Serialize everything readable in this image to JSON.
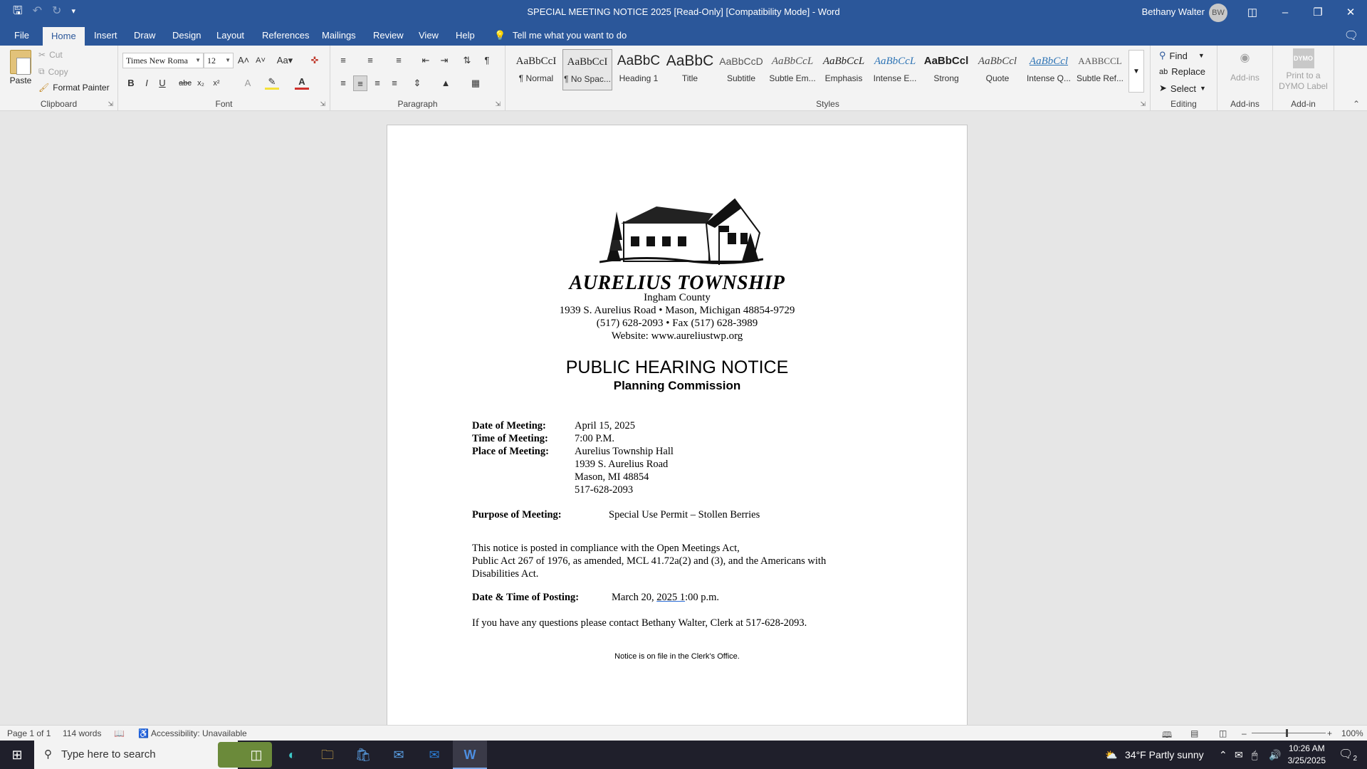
{
  "window": {
    "title": "SPECIAL MEETING NOTICE 2025 [Read-Only] [Compatibility Mode]  -  Word",
    "user_name": "Bethany Walter",
    "user_initials": "BW"
  },
  "tabs": [
    "File",
    "Home",
    "Insert",
    "Draw",
    "Design",
    "Layout",
    "References",
    "Mailings",
    "Review",
    "View",
    "Help"
  ],
  "tell_me": "Tell me what you want to do",
  "ribbon": {
    "clipboard": {
      "paste": "Paste",
      "cut": "Cut",
      "copy": "Copy",
      "format_painter": "Format Painter",
      "label": "Clipboard"
    },
    "font": {
      "name": "Times New Roma",
      "size": "12",
      "label": "Font"
    },
    "paragraph": {
      "label": "Paragraph"
    },
    "styles": {
      "label": "Styles",
      "items": [
        {
          "preview": "AaBbCcI",
          "name": "¶ Normal"
        },
        {
          "preview": "AaBbCcI",
          "name": "¶ No Spac..."
        },
        {
          "preview": "AaBbC",
          "name": "Heading 1"
        },
        {
          "preview": "AaBbC",
          "name": "Title"
        },
        {
          "preview": "AaBbCcD",
          "name": "Subtitle"
        },
        {
          "preview": "AaBbCcL",
          "name": "Subtle Em..."
        },
        {
          "preview": "AaBbCcL",
          "name": "Emphasis"
        },
        {
          "preview": "AaBbCcL",
          "name": "Intense E..."
        },
        {
          "preview": "AaBbCcl",
          "name": "Strong"
        },
        {
          "preview": "AaBbCcl",
          "name": "Quote"
        },
        {
          "preview": "AaBbCcl",
          "name": "Intense Q..."
        },
        {
          "preview": "AABBCCL",
          "name": "Subtle Ref..."
        }
      ]
    },
    "editing": {
      "find": "Find",
      "replace": "Replace",
      "select": "Select",
      "label": "Editing"
    },
    "addins": {
      "addins_btn": "Add-ins",
      "label": "Add-ins",
      "dymo_logo": "DYMO",
      "dymo_btn": "Print to a DYMO Label",
      "dymo_label": "Add-in"
    }
  },
  "document": {
    "township": "AURELIUS TOWNSHIP",
    "county": "Ingham County",
    "address": "1939 S. Aurelius Road • Mason, Michigan 48854-9729",
    "phone": "(517) 628-2093 • Fax (517) 628-3989",
    "website": "Website:  www.aureliustwp.org",
    "notice_title": "PUBLIC HEARING NOTICE",
    "notice_subtitle": "Planning Commission",
    "date_label": "Date of Meeting:",
    "date_value": "April 15, 2025",
    "time_label": "Time of Meeting:",
    "time_value": "7:00 P.M.",
    "place_label": "Place of Meeting:",
    "place_lines": [
      "Aurelius Township Hall",
      "1939 S. Aurelius Road",
      "Mason, MI  48854",
      "517-628-2093"
    ],
    "purpose_label": "Purpose of Meeting:",
    "purpose_value": "Special Use Permit – Stollen Berries",
    "compliance_lines": [
      "This notice is posted in compliance with the Open Meetings Act,",
      "Public Act 267 of 1976, as amended, MCL 41.72a(2) and (3), and the Americans with",
      "Disabilities Act."
    ],
    "posting_label": "Date & Time of Posting:",
    "posting_value_a": "March 20, ",
    "posting_value_b": "2025  1",
    "posting_value_c": ":00 p.m.",
    "contact": "If you have any questions please contact Bethany Walter, Clerk at 517-628-2093.",
    "footer": "Notice is on file in the Clerk’s Office."
  },
  "statusbar": {
    "page": "Page 1 of 1",
    "words": "114 words",
    "accessibility": "Accessibility: Unavailable",
    "zoom": "100%"
  },
  "taskbar": {
    "search_placeholder": "Type here to search",
    "weather": "34°F  Partly sunny",
    "time": "10:26 AM",
    "date": "3/25/2025",
    "notif_count": "2"
  },
  "colors": {
    "word_blue": "#2b579a",
    "taskbar": "#1f1f2b"
  }
}
